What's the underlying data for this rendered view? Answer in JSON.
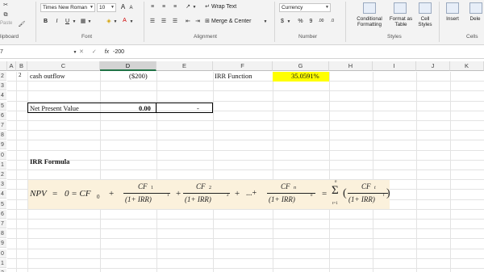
{
  "ribbon": {
    "clipboard": {
      "paste_label": "Paste",
      "group_label": "lipboard"
    },
    "font": {
      "name": "Times New Roman",
      "size": "10",
      "grow": "A",
      "shrink": "A",
      "bold": "B",
      "italic": "I",
      "underline": "U",
      "font_color_letter": "A",
      "group_label": "Font"
    },
    "alignment": {
      "wrap_text": "Wrap Text",
      "merge_center": "Merge & Center",
      "group_label": "Alignment"
    },
    "number": {
      "format": "Currency",
      "dollar": "$",
      "percent": "%",
      "comma": "9",
      "inc_dec": ".00",
      "dec_dec": ".0",
      "group_label": "Number"
    },
    "styles": {
      "conditional": [
        "Conditional",
        "Formatting"
      ],
      "format_table": [
        "Format as",
        "Table"
      ],
      "cell_styles": [
        "Cell",
        "Styles"
      ],
      "group_label": "Styles"
    },
    "cells": {
      "insert": "Insert",
      "delete": "Dele",
      "group_label": "Cells"
    }
  },
  "formula_bar": {
    "name_box": "7",
    "fx": "fx",
    "content": "-200"
  },
  "columns": [
    "A",
    "B",
    "C",
    "D",
    "E",
    "F",
    "G",
    "H",
    "I",
    "J",
    "K"
  ],
  "rows": [
    "2",
    "3",
    "4",
    "5",
    "6",
    "7",
    "8",
    "9",
    "0",
    "1",
    "2",
    "3",
    "4",
    "5",
    "6",
    "7",
    "8",
    "9",
    "0",
    "1",
    "2"
  ],
  "cells": {
    "row2_b": "2",
    "cash_outflow": "cash outflow",
    "cash_outflow_val": "($200)",
    "irr_function_label": "IRR Function",
    "irr_value": "35.0591%",
    "npv_label": "Net Present Value",
    "npv_value": "0.00",
    "npv_dash": "-",
    "irr_formula_title": "IRR Formula"
  },
  "formula_image": {
    "npv": "NPV",
    "eq1": "=",
    "zero_eq": "0 = CF",
    "cf0_sub": "0",
    "plus1": "+",
    "cf1_num": "CF",
    "cf1_sub": "1",
    "den1": "(1+ IRR)",
    "exp1": "1",
    "plus2": "+",
    "cf2_num": "CF",
    "cf2_sub": "2",
    "den2": "(1+ IRR)",
    "exp2": "2",
    "plus3": "+",
    "ellipsis": "...+",
    "cfn_num": "CF",
    "cfn_sub": "n",
    "den_n": "(1+ IRR)",
    "exp_n": "n",
    "eq2": "=",
    "sigma": "Σ",
    "sigma_top": "n",
    "sigma_bottom": "t=1",
    "paren_open": "(",
    "cft_num": "CF",
    "cft_sub": "t",
    "den_t": "(1+ IRR)",
    "exp_t": "t",
    "paren_close": ")"
  },
  "colors": {
    "highlight": "#ffff00",
    "formula_bg": "#fbf1dc",
    "active_header": "#217346"
  }
}
